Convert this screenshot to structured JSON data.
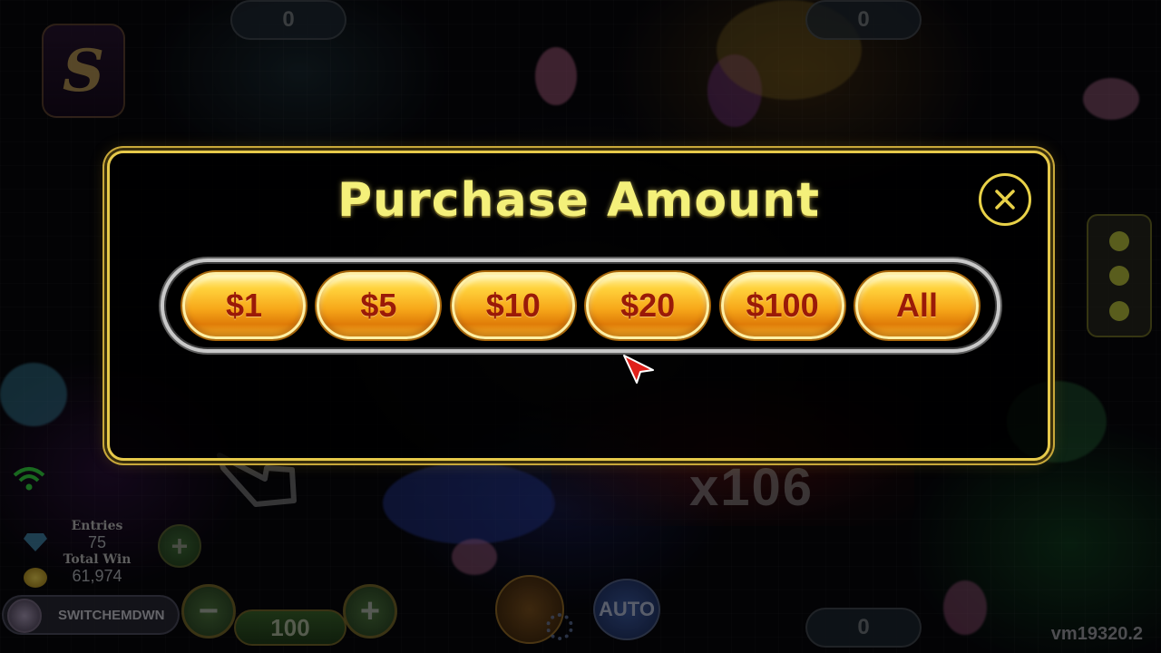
{
  "scene": {
    "seat_top_left": "0",
    "seat_top_right": "0",
    "seat_bottom_right": "0",
    "multiplier": "x106",
    "version": "vm19320.2"
  },
  "hud": {
    "entries_label": "Entries",
    "entries_value": "75",
    "total_win_label": "Total Win",
    "total_win_value": "61,974",
    "player_name": "SWITCHEMDWN",
    "bet_value": "100",
    "bet_minus": "−",
    "bet_plus": "+",
    "add": "+",
    "auto_label": "AUTO"
  },
  "modal": {
    "title": "Purchase Amount",
    "options": [
      "$1",
      "$5",
      "$10",
      "$20",
      "$100",
      "All"
    ]
  },
  "colors": {
    "title": "#f4f07a",
    "modal_border": "#e6c94a",
    "button_text": "#9a1a08",
    "button_gold": "#f7a81a"
  },
  "icons": {
    "close": "close-icon",
    "cursor": "cursor-arrow-icon",
    "wifi": "wifi-icon",
    "gem": "gem-icon",
    "coin": "coin-icon"
  }
}
